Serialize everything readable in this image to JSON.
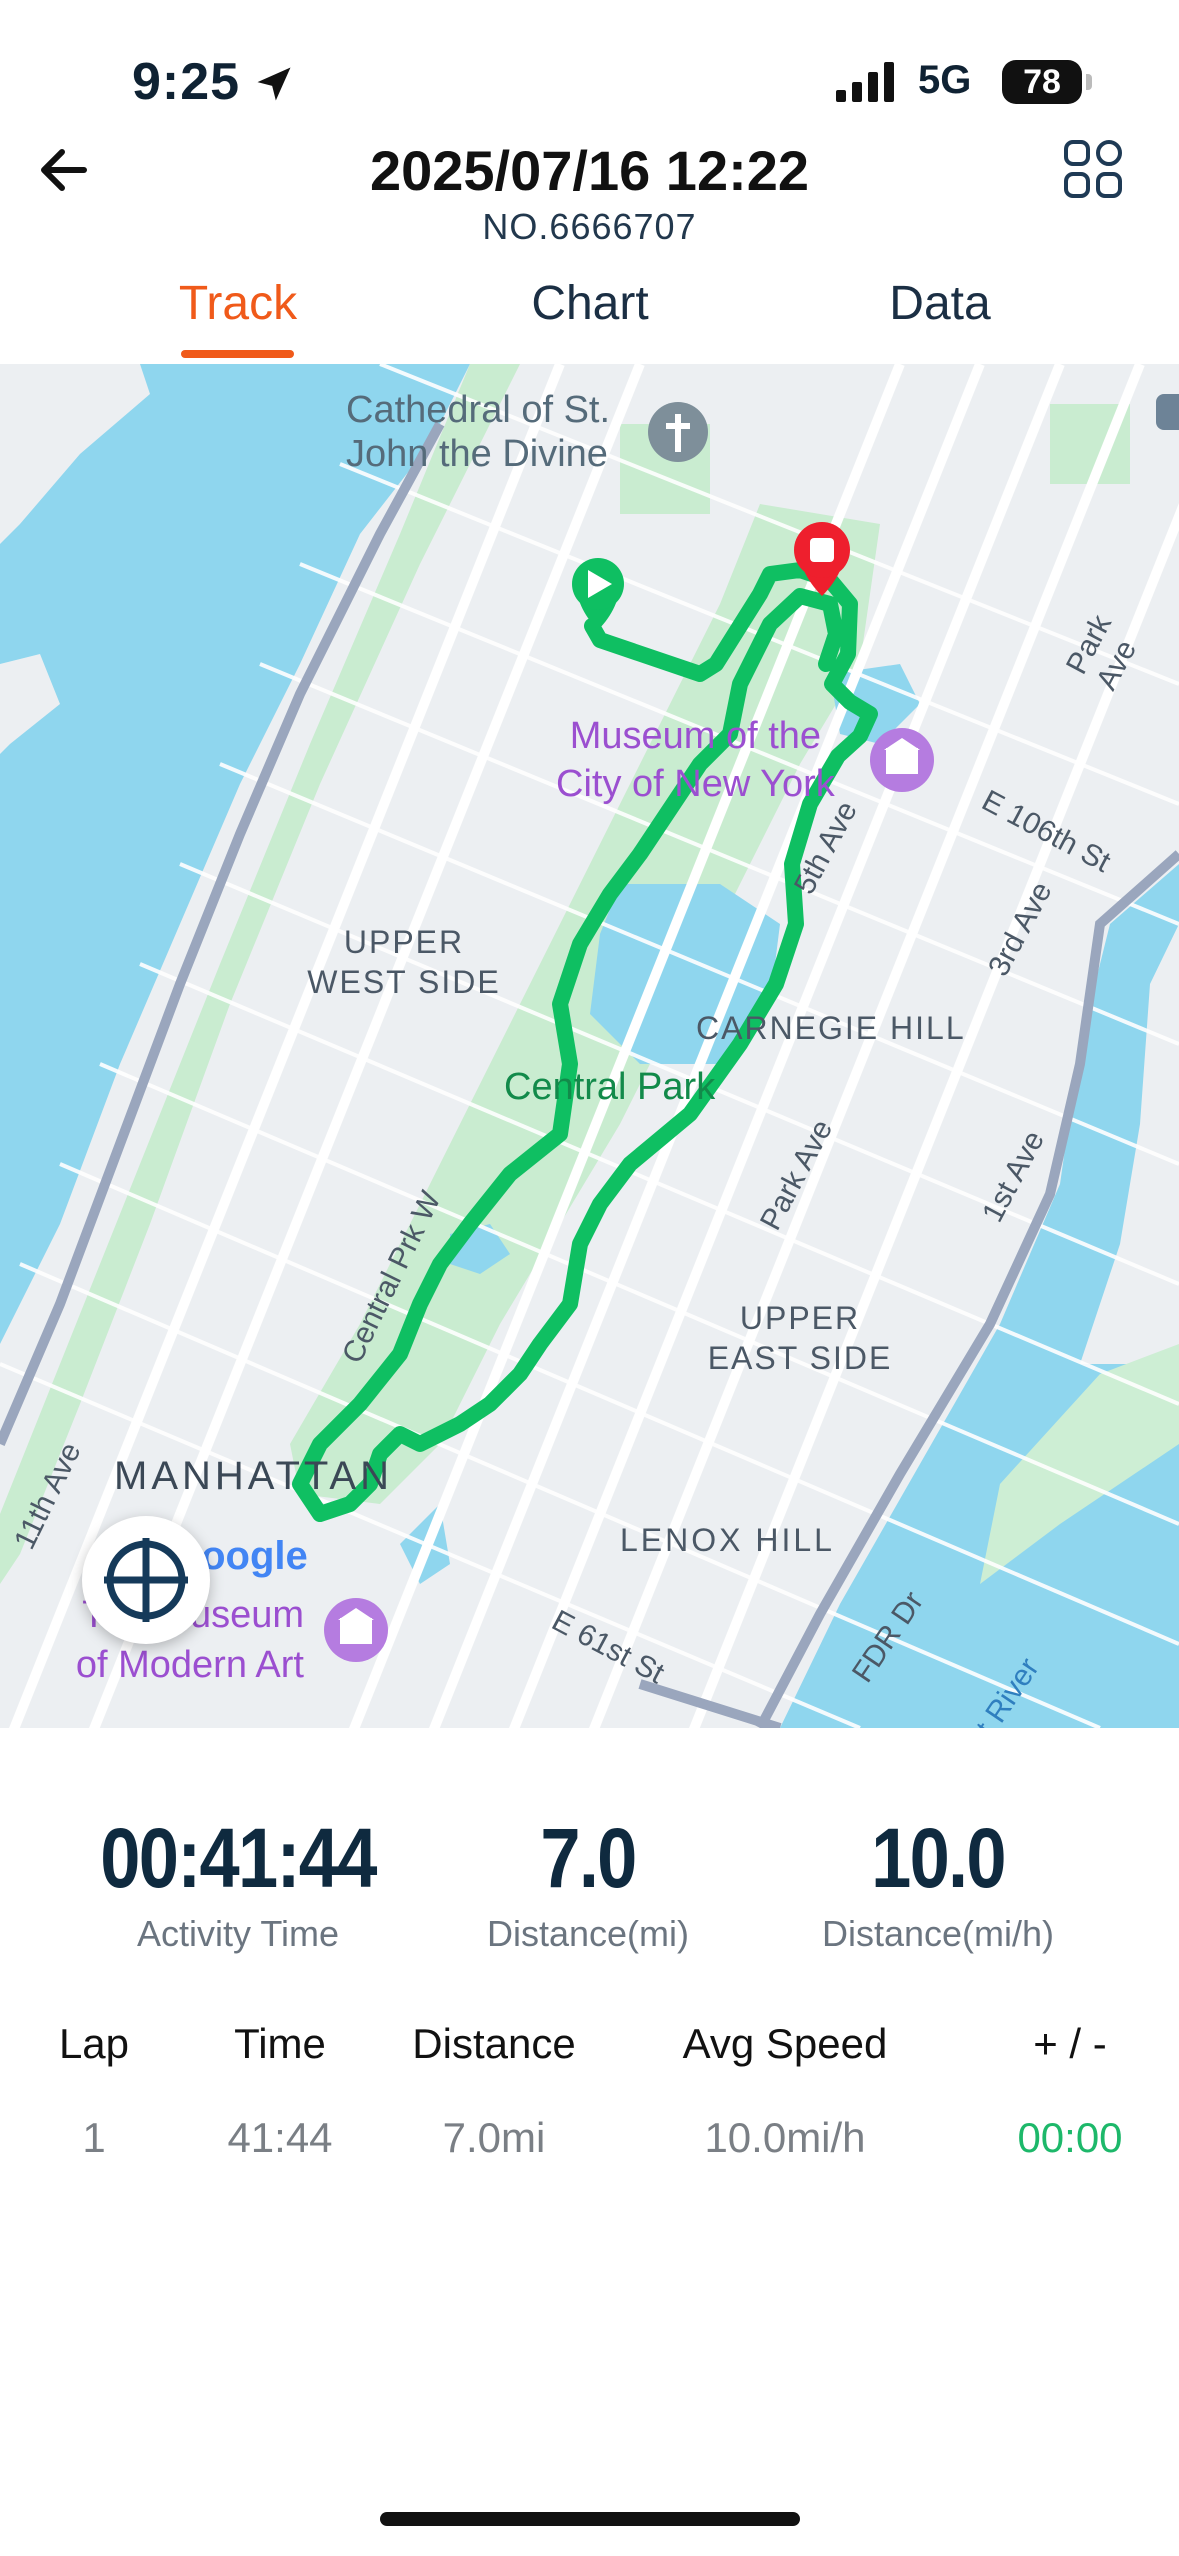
{
  "status_bar": {
    "time": "9:25",
    "network": "5G",
    "battery": "78"
  },
  "header": {
    "title": "2025/07/16 12:22",
    "subtitle": "NO.6666707"
  },
  "tabs": [
    {
      "label": "Track",
      "active": true
    },
    {
      "label": "Chart",
      "active": false
    },
    {
      "label": "Data",
      "active": false
    }
  ],
  "map": {
    "labels": {
      "cathedral_1": "Cathedral of St.",
      "cathedral_2": "John the Divine",
      "museum_ny_1": "Museum of the",
      "museum_ny_2": "City of New York",
      "upper_west_1": "UPPER",
      "upper_west_2": "WEST SIDE",
      "carnegie": "CARNEGIE HILL",
      "central_park": "Central Park",
      "upper_east_1": "UPPER",
      "upper_east_2": "EAST SIDE",
      "manhattan": "MANHATTAN",
      "lenox": "LENOX HILL",
      "moma_1": "The Museum",
      "moma_2": "of Modern Art",
      "google": "Google",
      "fifth_ave": "5th Ave",
      "park_ave_top": "Park Ave",
      "park_ave_mid": "Park Ave",
      "third_ave": "3rd Ave",
      "first_ave": "1st Ave",
      "e106": "E 106th St",
      "e61": "E 61st St",
      "cpw": "Central Prk W",
      "eleventh": "11th Ave",
      "fdr": "FDR Dr",
      "river": "t River"
    },
    "colors": {
      "route": "#0fbf62",
      "water": "#8fd6ee",
      "park": "#c9ecd0",
      "start": "#0fbf62",
      "end": "#ee1f2d"
    }
  },
  "stats": [
    {
      "value": "00:41:44",
      "label": "Activity Time"
    },
    {
      "value": "7.0",
      "label": "Distance(mi)"
    },
    {
      "value": "10.0",
      "label": "Distance(mi/h)"
    }
  ],
  "laps": {
    "headers": [
      "Lap",
      "Time",
      "Distance",
      "Avg Speed",
      "+ / -"
    ],
    "rows": [
      [
        "1",
        "41:44",
        "7.0mi",
        "10.0mi/h",
        "00:00"
      ]
    ]
  }
}
